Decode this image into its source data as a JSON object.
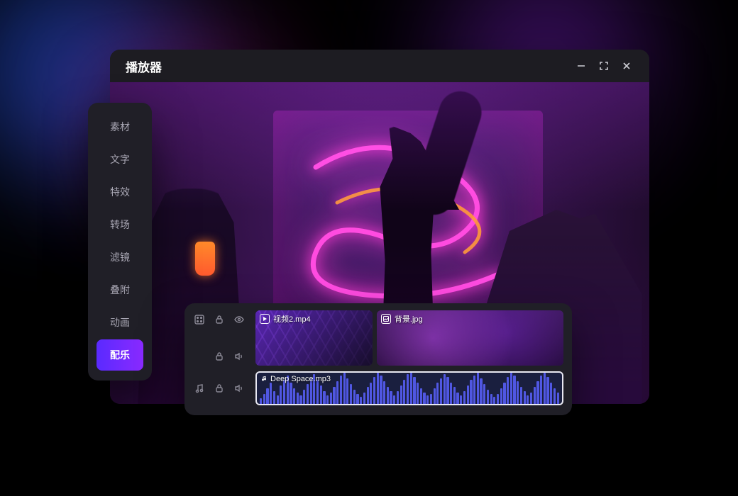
{
  "window": {
    "title": "播放器"
  },
  "sidebar": {
    "items": [
      {
        "label": "素材"
      },
      {
        "label": "文字"
      },
      {
        "label": "特效"
      },
      {
        "label": "转场"
      },
      {
        "label": "滤镜"
      },
      {
        "label": "叠附"
      },
      {
        "label": "动画"
      },
      {
        "label": "配乐"
      }
    ],
    "activeIndex": 7
  },
  "timeline": {
    "videoClips": [
      {
        "label": "视频2.mp4",
        "type": "video"
      },
      {
        "label": "背景.jpg",
        "type": "image"
      }
    ],
    "audioClip": {
      "label": "Deep Space.mp3"
    }
  }
}
